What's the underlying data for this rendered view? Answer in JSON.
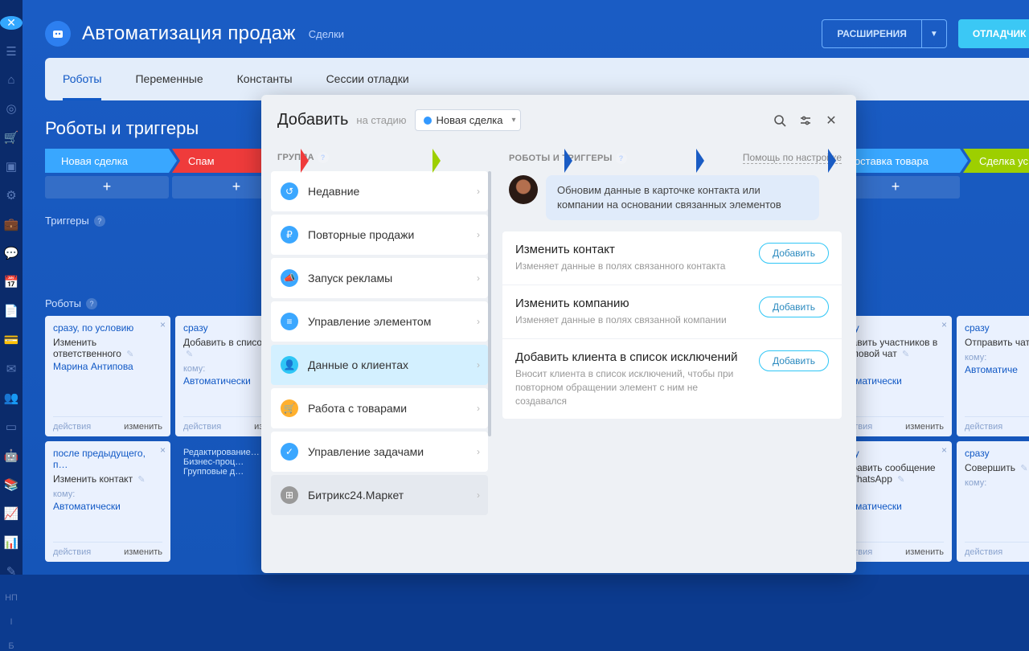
{
  "sidebar": {
    "letters": [
      "НП",
      "I",
      "Б"
    ]
  },
  "header": {
    "title": "Автоматизация продаж",
    "subtitle": "Сделки",
    "extensions": "РАСШИРЕНИЯ",
    "debugger": "ОТЛАДЧИК РОБОТОВ"
  },
  "tabs": [
    "Роботы",
    "Переменные",
    "Константы",
    "Сессии отладки"
  ],
  "section": {
    "title": "Роботы и триггеры"
  },
  "triggers_label": "Триггеры",
  "robots_label": "Роботы",
  "stages": [
    {
      "name": "Новая сделка",
      "color": "#39a7ff"
    },
    {
      "name": "Спам",
      "color": "#ef3b3b"
    },
    {
      "name": "",
      "color": "#9dcf00"
    },
    {
      "name": "",
      "color": "#1a5cc4"
    },
    {
      "name": "",
      "color": "#1a5cc4"
    },
    {
      "name": "",
      "color": "#1a5cc4"
    },
    {
      "name": "Доставка товара",
      "color": "#39a7ff"
    },
    {
      "name": "Сделка ус",
      "color": "#9dcf00"
    }
  ],
  "stage_plus": "+",
  "cards": {
    "row1": [
      {
        "when": "сразу, по условию",
        "name": "Изменить ответственного",
        "to_val": "Марина Антипова",
        "to_lbl": ""
      },
      {
        "when": "сразу",
        "name": "Добавить в список ис…",
        "to_lbl": "кому:",
        "to_val": "Автоматически"
      },
      {
        "blank": true
      },
      {
        "blank": true
      },
      {
        "blank": true
      },
      {
        "blank": true
      },
      {
        "when": "сразу",
        "name": "Добавить участников в групповой чат",
        "to_lbl": "кому:",
        "to_val": "Автоматически"
      },
      {
        "when": "сразу",
        "name": "Отправить чат",
        "to_lbl": "кому:",
        "to_val": "Автоматиче"
      }
    ],
    "row2": [
      {
        "when": "после предыдущего, п…",
        "name": "Изменить контакт",
        "to_lbl": "кому:",
        "to_val": "Автоматически"
      },
      {
        "alt": true,
        "lines": [
          "Редактирование…",
          "Бизнес-проц…",
          "",
          "Групповые д…"
        ]
      },
      {
        "blank": true
      },
      {
        "blank": true
      },
      {
        "blank": true
      },
      {
        "blank": true
      },
      {
        "when": "сразу",
        "name": "Отправить сообщение по WhatsApp",
        "to_lbl": "кому:",
        "to_val": "Автоматически"
      },
      {
        "when": "сразу",
        "name": "Совершить",
        "to_lbl": "кому:",
        "to_val": ""
      }
    ],
    "actions_lbl": "действия",
    "edit_lbl": "изменить"
  },
  "modal": {
    "title": "Добавить",
    "stage_lbl": "на стадию",
    "stage_val": "Новая сделка",
    "left_head": "ГРУППА",
    "groups": [
      {
        "icon": "↺",
        "bg": "#3ba7ff",
        "label": "Недавние"
      },
      {
        "icon": "₽",
        "bg": "#3ba7ff",
        "label": "Повторные продажи"
      },
      {
        "icon": "📣",
        "bg": "#3ba7ff",
        "label": "Запуск рекламы"
      },
      {
        "icon": "≡",
        "bg": "#3ba7ff",
        "label": "Управление элементом"
      },
      {
        "icon": "👤",
        "bg": "#2fc6f6",
        "label": "Данные о клиентах",
        "active": true
      },
      {
        "icon": "🛒",
        "bg": "#ffb02e",
        "label": "Работа с товарами"
      },
      {
        "icon": "✓",
        "bg": "#3ba7ff",
        "label": "Управление задачами"
      },
      {
        "icon": "⊞",
        "bg": "#999",
        "label": "Битрикс24.Маркет",
        "market": true
      }
    ],
    "right_head": "РОБОТЫ И ТРИГГЕРЫ",
    "help_link": "Помощь по настройке",
    "bubble": "Обновим данные в карточке контакта или компании на основании связанных элементов",
    "actions": [
      {
        "title": "Изменить контакт",
        "desc": "Изменяет данные в полях связанного контакта"
      },
      {
        "title": "Изменить компанию",
        "desc": "Изменяет данные в полях связанной компании"
      },
      {
        "title": "Добавить клиента в список исключений",
        "desc": "Вносит клиента в список исключений, чтобы при повторном обращении элемент с ним не создавался"
      }
    ],
    "add_btn": "Добавить"
  }
}
